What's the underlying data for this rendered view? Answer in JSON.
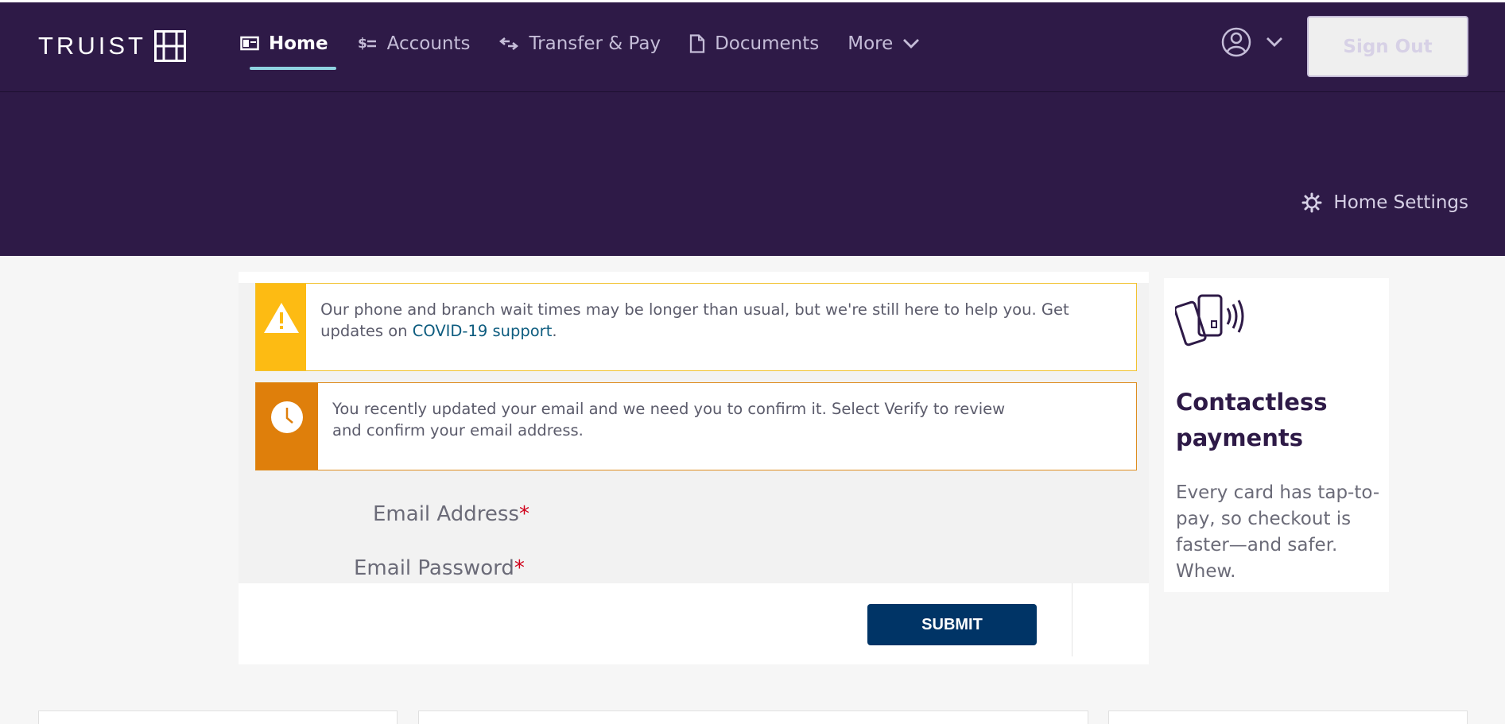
{
  "brand": {
    "name": "TRUIST"
  },
  "nav": {
    "items": [
      {
        "label": "Home",
        "icon": "dashboard-icon"
      },
      {
        "label": "Accounts",
        "icon": "dollar-list-icon"
      },
      {
        "label": "Transfer & Pay",
        "icon": "transfer-arrows-icon"
      },
      {
        "label": "Documents",
        "icon": "document-icon"
      },
      {
        "label": "More",
        "icon": "chevron-down-icon"
      }
    ]
  },
  "header": {
    "sign_out_label": "Sign Out"
  },
  "banner": {
    "home_settings_label": "Home Settings"
  },
  "alerts": {
    "covid": {
      "text_before": "Our phone and branch wait times may be longer than usual, but we're still here to help you. Get updates on ",
      "link_text": "COVID-19 support",
      "text_after": "."
    },
    "email": {
      "line1": "You recently updated your email and we need you to confirm it. Select Verify to review",
      "line2": "and confirm your email address."
    }
  },
  "form": {
    "email_label": "Email Address",
    "password_label": "Email Password",
    "required_mark": "*",
    "submit_label": "SUBMIT"
  },
  "promo": {
    "title": "Contactless payments",
    "body": "Every card has tap-to-pay, so checkout is faster—and safer. Whew."
  },
  "colors": {
    "header_bg": "#2e1a47",
    "warning_yellow": "#fdbb13",
    "clock_orange": "#df7f0b",
    "submit_navy": "#003466",
    "active_underline": "#8fd3e1"
  }
}
